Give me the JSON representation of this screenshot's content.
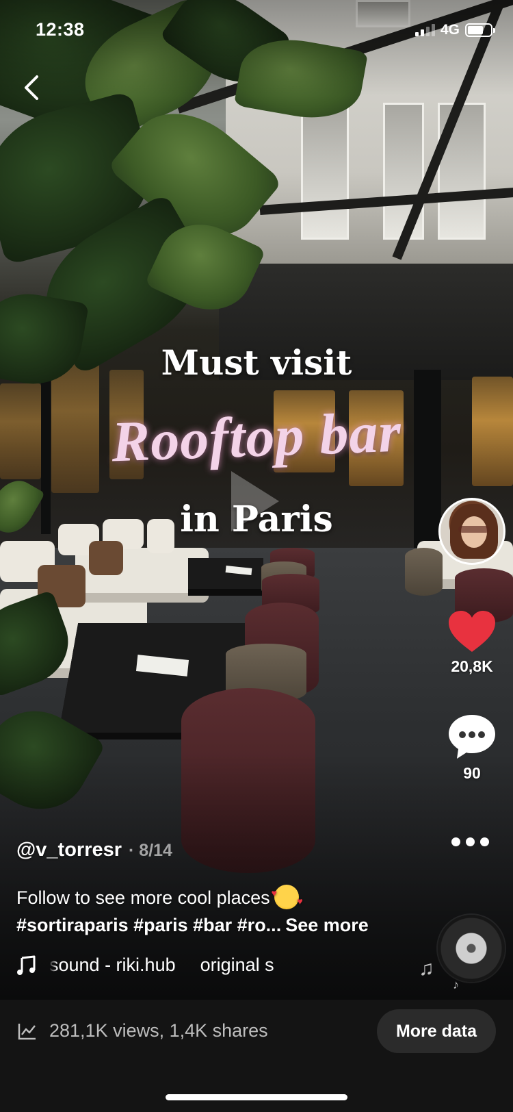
{
  "status_bar": {
    "time": "12:38",
    "network": "4G"
  },
  "overlay": {
    "line1": "Must visit",
    "line2": "Rooftop bar",
    "line3": "in Paris"
  },
  "actions": {
    "likes": "20,8K",
    "comments": "90"
  },
  "post": {
    "username": "@v_torresr",
    "page_indicator": "· 8/14",
    "description": "Follow to see more cool places",
    "hashtags": "#sortiraparis #paris #bar #ro...",
    "see_more": "See more",
    "sound_part1": "sound - riki.hub",
    "sound_part2": "original s"
  },
  "insights": {
    "stats": "281,1K views, 1,4K shares",
    "more_data_label": "More data"
  },
  "colors": {
    "like": "#e8323f",
    "overlay_script": "#f3d3e8",
    "insight_bar": "#141414"
  },
  "icons": [
    "back-chevron-icon",
    "heart-icon",
    "comment-icon",
    "more-dots-icon",
    "music-note-icon",
    "analytics-icon",
    "sound-disc-icon"
  ]
}
